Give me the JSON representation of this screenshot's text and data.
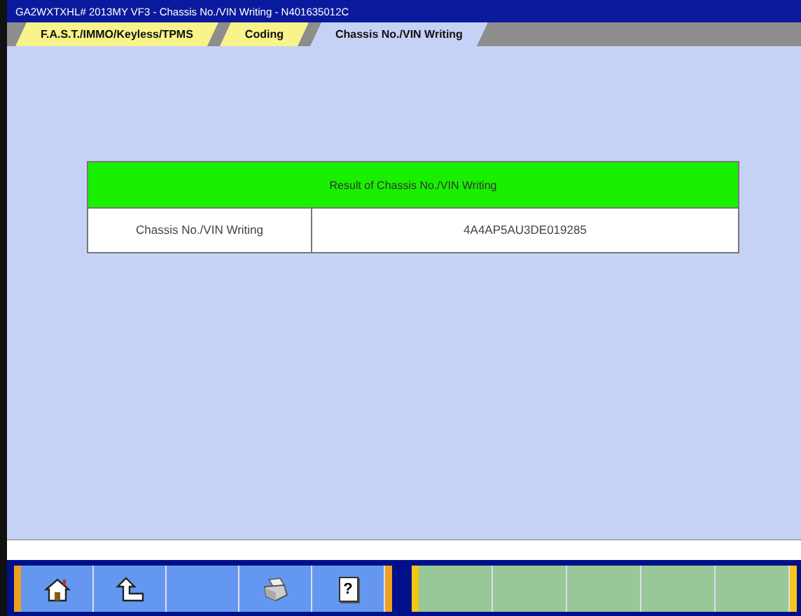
{
  "window": {
    "title": "GA2WXTXHL# 2013MY VF3  -  Chassis No./VIN Writing  -  N401635012C"
  },
  "tabs": [
    {
      "label": "F.A.S.T./IMMO/Keyless/TPMS",
      "selected": false
    },
    {
      "label": "Coding",
      "selected": false
    },
    {
      "label": "Chassis No./VIN Writing",
      "selected": true
    }
  ],
  "result_table": {
    "title": "Result of Chassis No./VIN Writing",
    "rows": [
      {
        "label": "Chassis No./VIN Writing",
        "value": "4A4AP5AU3DE019285"
      }
    ]
  },
  "toolbar": [
    {
      "kind": "home"
    },
    {
      "kind": "back"
    },
    {
      "kind": "blank"
    },
    {
      "kind": "print"
    },
    {
      "kind": "help",
      "label": "?"
    }
  ],
  "function_keys": [
    {
      "kind": "blank"
    },
    {
      "kind": "blank"
    },
    {
      "kind": "blank"
    },
    {
      "kind": "blank"
    },
    {
      "kind": "blank"
    }
  ]
}
